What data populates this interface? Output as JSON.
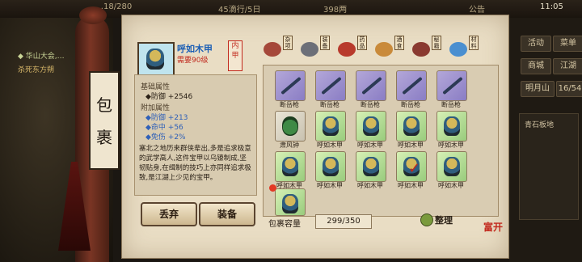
{
  "hud": {
    "top_left_value": "…18/280",
    "top_mid_value": "45滴行/5日",
    "top_money": "398两",
    "notice": "公告",
    "clock": "11:05"
  },
  "quest": {
    "line1": "◆ 华山大会,…",
    "line2": "杀死东方朔"
  },
  "right_side": {
    "btn1": "活动",
    "btn2": "菜单",
    "btn3": "商城",
    "btn4": "江湖",
    "location": "明月山",
    "location2": "16/54",
    "panel_item": "青石板地"
  },
  "bag": {
    "title_char1": "包",
    "title_char2": "裹",
    "item": {
      "name": "呼如木甲",
      "requirement": "需要90级",
      "seal": "内甲",
      "base_header": "基础属性",
      "base_stat": "◆防御 +2546",
      "extra_header": "附加属性",
      "extra_stats": [
        "◆防御 +213",
        "◆命中 +56",
        "◆免伤 +2%"
      ],
      "description": "塞北之地历来群侠辈出,多是追求极意的武学高人,这件宝甲以乌镣制成,坚韧贴身,在缉制的技巧上亦同样追求极致,是江湖上少见的宝甲。"
    },
    "buttons": {
      "discard": "丢弃",
      "equip": "装备"
    },
    "tabs": [
      "杂项",
      "装备",
      "药品",
      "酒食",
      "秘籍",
      "材料"
    ],
    "slot_labels": {
      "spear": "断岳枪",
      "armor": "呼如木甲",
      "bag": "肃风钟"
    },
    "grid_rows": [
      [
        "断岳枪",
        "断岳枪",
        "断岳枪",
        "断岳枪",
        "断岳枪"
      ],
      [
        "肃风钟",
        "呼如木甲",
        "呼如木甲",
        "呼如木甲",
        "呼如木甲"
      ],
      [
        "呼如木甲",
        "呼如木甲",
        "呼如木甲",
        "呼如木甲",
        "呼如木甲"
      ],
      [
        "呼如木甲"
      ]
    ],
    "capacity_label": "包裹容量",
    "capacity_value": "299/350",
    "sort_label": "整理",
    "stamp": "富开"
  },
  "colors": {
    "paper": "#e9ddc4",
    "accent_red": "#c2281c",
    "name_blue": "#1c5fb5"
  }
}
